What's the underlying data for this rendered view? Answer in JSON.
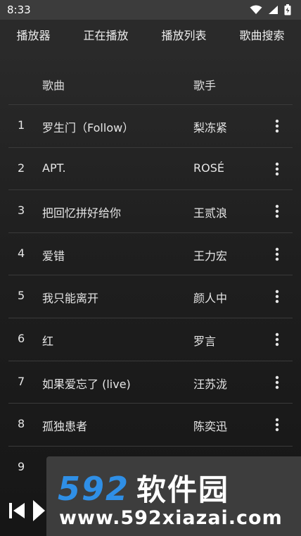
{
  "status_bar": {
    "time": "8:33"
  },
  "tabs": [
    {
      "label": "播放器"
    },
    {
      "label": "正在播放"
    },
    {
      "label": "播放列表"
    },
    {
      "label": "歌曲搜索"
    }
  ],
  "table": {
    "header_song": "歌曲",
    "header_artist": "歌手",
    "rows": [
      {
        "num": "1",
        "title": "罗生门（Follow）",
        "artist": "梨冻紧"
      },
      {
        "num": "2",
        "title": "APT.",
        "artist": "ROSÉ"
      },
      {
        "num": "3",
        "title": "把回忆拼好给你",
        "artist": "王贰浪"
      },
      {
        "num": "4",
        "title": "爱错",
        "artist": "王力宏"
      },
      {
        "num": "5",
        "title": "我只能离开",
        "artist": "颜人中"
      },
      {
        "num": "6",
        "title": "红",
        "artist": "罗言"
      },
      {
        "num": "7",
        "title": "如果爱忘了 (live)",
        "artist": "汪苏泷"
      },
      {
        "num": "8",
        "title": "孤独患者",
        "artist": "陈奕迅"
      },
      {
        "num": "9",
        "title": "",
        "artist": ""
      }
    ]
  },
  "watermark": {
    "logo_number": "592",
    "logo_text": "软件园",
    "url": "www.592xiazai.com"
  },
  "icons": {
    "wifi": "wifi-icon",
    "signal": "signal-icon",
    "battery": "battery-icon",
    "more": "more-vert-icon",
    "previous": "skip-previous-icon",
    "play": "play-icon"
  }
}
